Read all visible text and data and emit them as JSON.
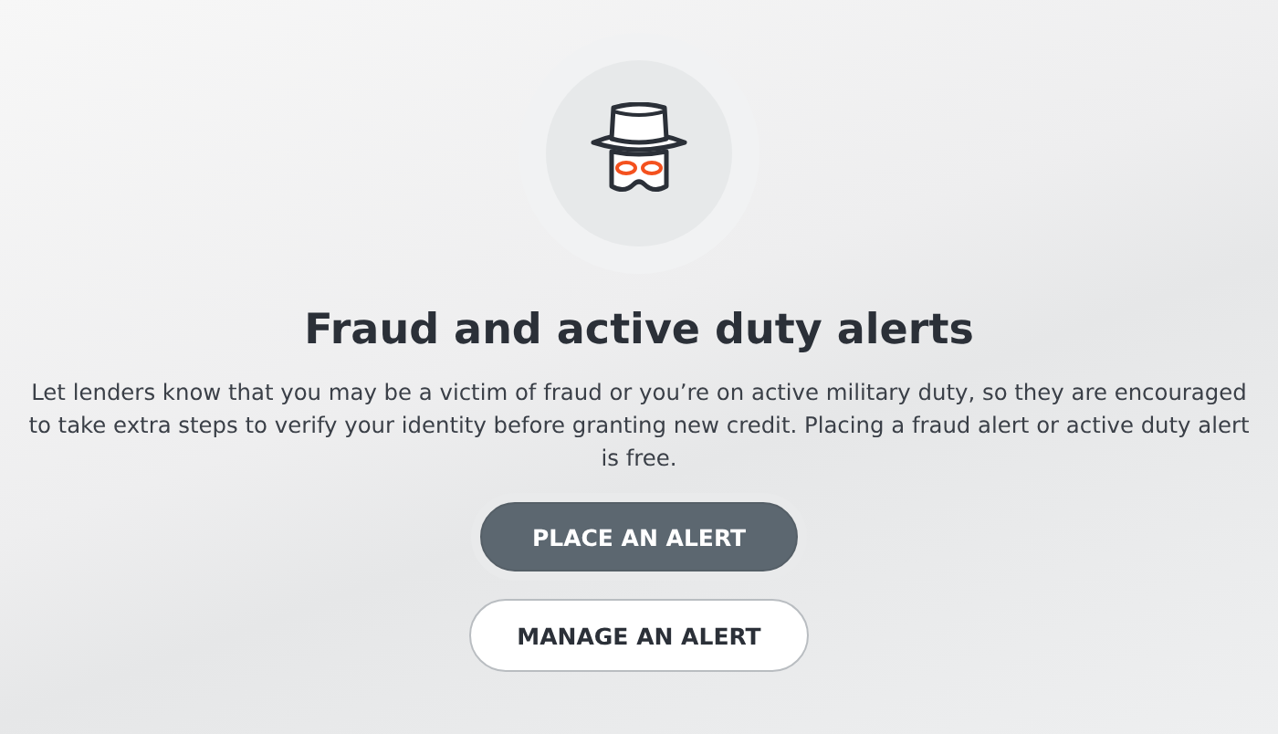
{
  "title": "Fraud and active duty alerts",
  "description": "Let lenders know that you may be a victim of fraud or you’re on active military duty, so they are encouraged to take extra steps to verify your identity before granting new credit. Placing a fraud alert or active duty alert is free.",
  "buttons": [
    {
      "label": "PLACE AN ALERT",
      "kind": "primary"
    },
    {
      "label": "MANAGE AN ALERT",
      "kind": "secondary"
    }
  ]
}
